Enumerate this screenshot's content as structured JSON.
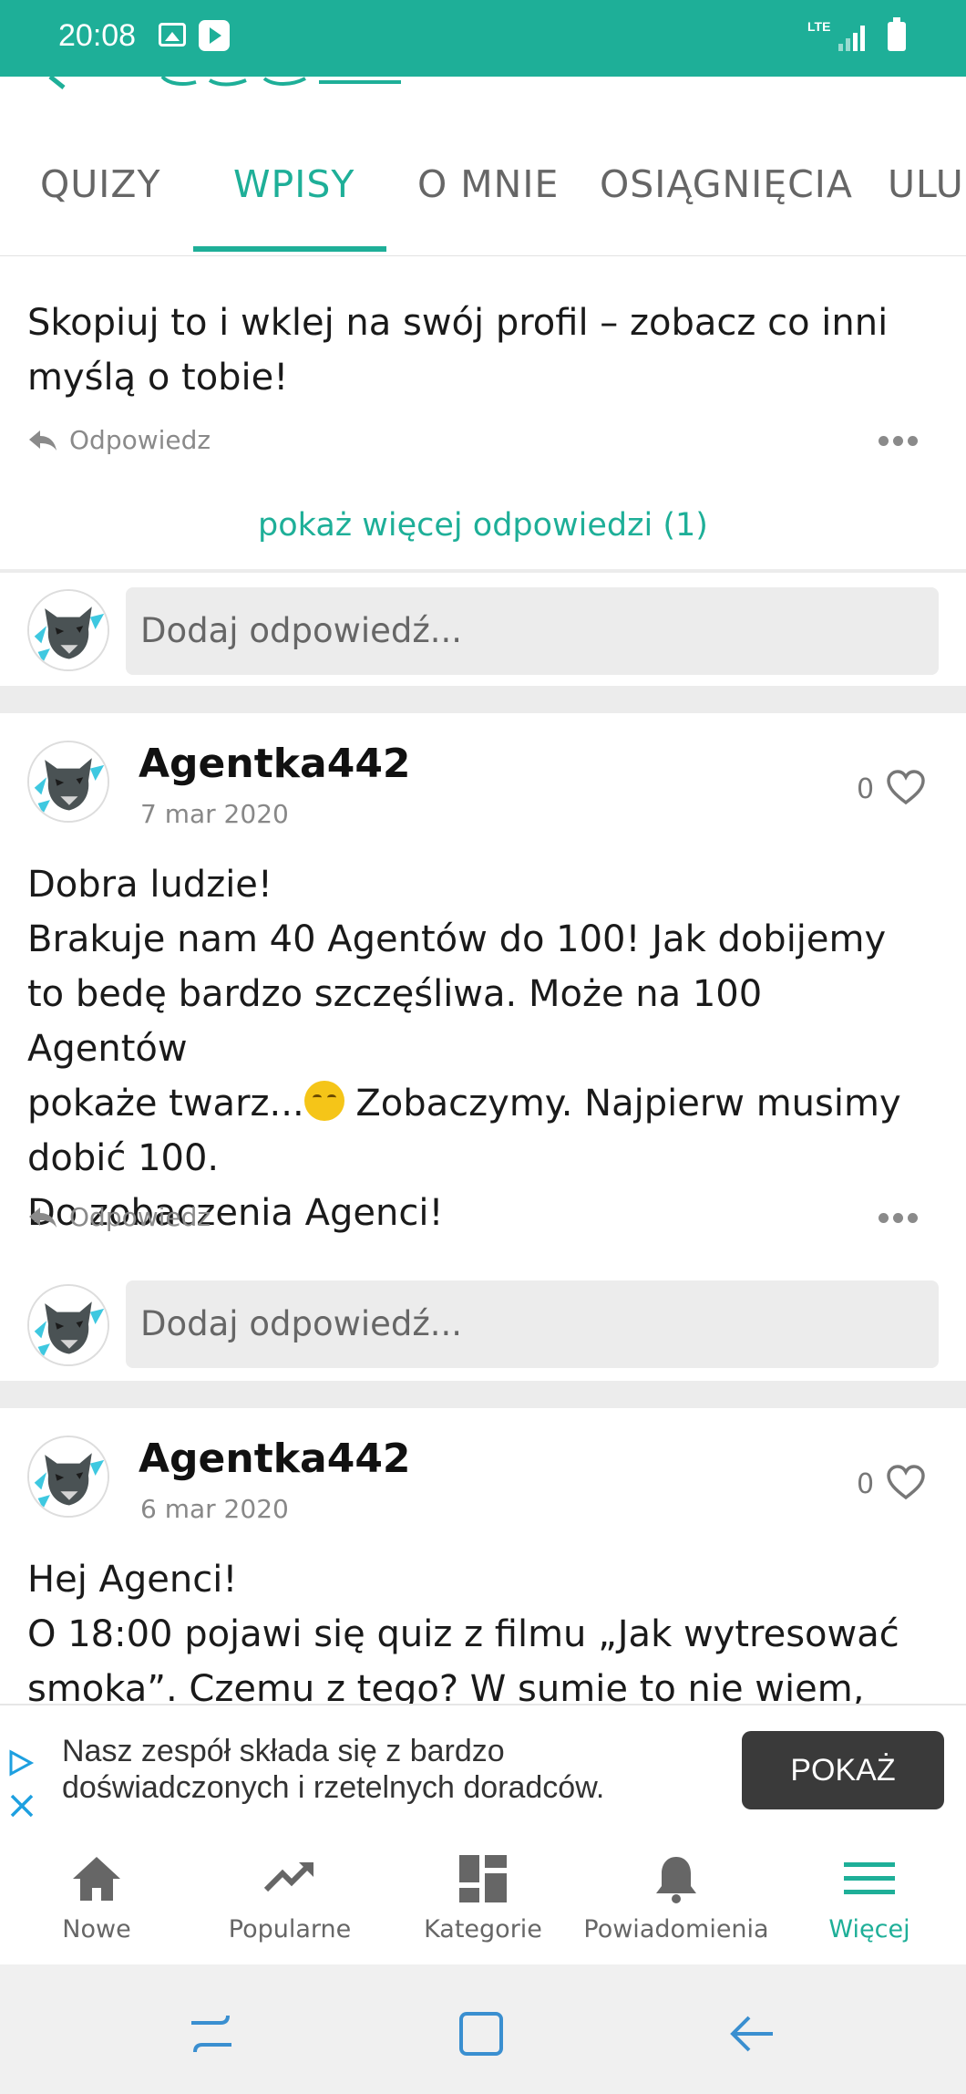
{
  "status_bar": {
    "time": "20:08",
    "network": "LTE",
    "icons": [
      "image-icon",
      "play-store-icon",
      "signal-icon",
      "battery-icon"
    ]
  },
  "tabs": [
    {
      "label": "QUIZY",
      "active": false
    },
    {
      "label": "WPISY",
      "active": true
    },
    {
      "label": "O MNIE",
      "active": false
    },
    {
      "label": "OSIĄGNIĘCIA",
      "active": false
    },
    {
      "label": "ULU",
      "active": false
    }
  ],
  "top_post": {
    "text": "Skopiuj to i wklej na swój profil – zobacz co inni myślą o tobie!",
    "reply_label": "Odpowiedz",
    "show_more": "pokaż więcej odpowiedzi (1)",
    "reply_placeholder": "Dodaj odpowiedź..."
  },
  "posts": [
    {
      "author": "Agentka442",
      "date": "7 mar 2020",
      "likes": "0",
      "lines": [
        "Dobra ludzie!",
        "Brakuje nam 40 Agentów do 100! Jak dobijemy",
        "to bedę bardzo szczęśliwa. Może na 100 Agentów",
        "pokaże twarz...",
        "Zobaczymy. Najpierw musimy",
        "dobić 100.",
        "Do zobaczenia Agenci!"
      ],
      "reply_label": "Odpowiedz",
      "reply_placeholder": "Dodaj odpowiedź..."
    },
    {
      "author": "Agentka442",
      "date": "6 mar 2020",
      "likes": "0",
      "lines": [
        "Hej Agenci!",
        "O 18:00 pojawi się quiz z filmu „Jak wytresować",
        "smoka”. Czemu z tego? W sumie to nie wiem, ale"
      ]
    }
  ],
  "ad": {
    "text": "Nasz zespół składa się z bardzo doświadczonych i rzetelnych doradców.",
    "button": "POKAŻ"
  },
  "bottom_nav": [
    {
      "label": "Nowe",
      "icon": "home-icon",
      "active": false
    },
    {
      "label": "Popularne",
      "icon": "trending-icon",
      "active": false
    },
    {
      "label": "Kategorie",
      "icon": "categories-icon",
      "active": false
    },
    {
      "label": "Powiadomienia",
      "icon": "bell-icon",
      "active": false
    },
    {
      "label": "Więcej",
      "icon": "menu-icon",
      "active": true
    }
  ],
  "colors": {
    "accent": "#1eaf98",
    "ad_button": "#3a3a3a"
  }
}
